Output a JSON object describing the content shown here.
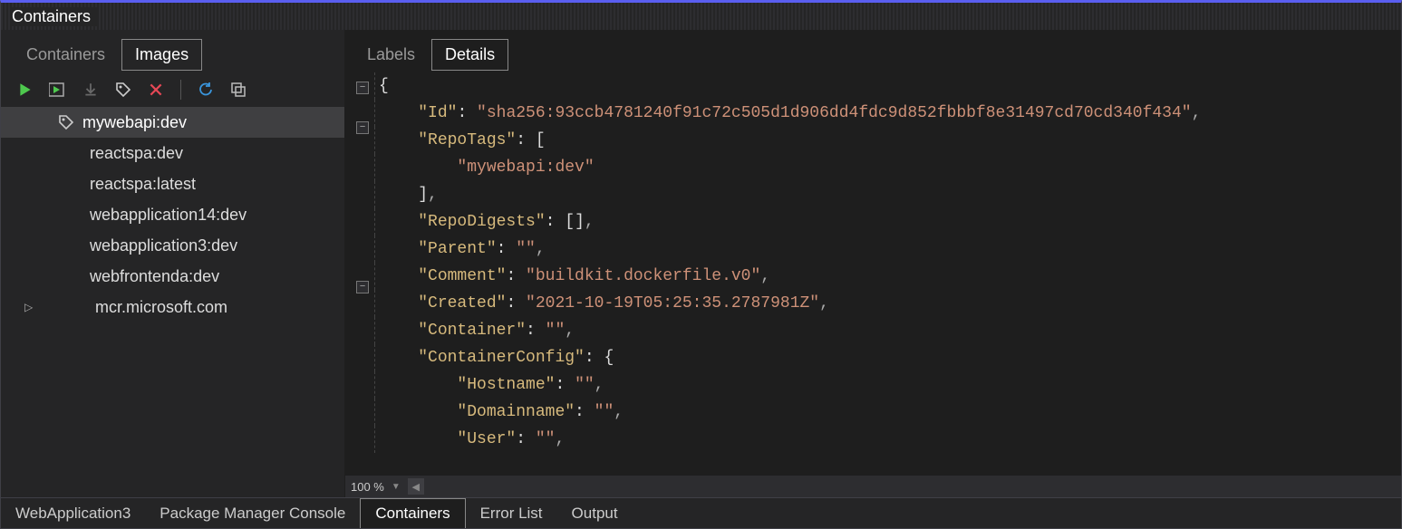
{
  "title": "Containers",
  "left": {
    "tabs": {
      "containers": "Containers",
      "images": "Images",
      "active": "images"
    },
    "items": [
      {
        "label": "mywebapi:dev",
        "selected": true,
        "tagged": true
      },
      {
        "label": "reactspa:dev"
      },
      {
        "label": "reactspa:latest"
      },
      {
        "label": "webapplication14:dev"
      },
      {
        "label": "webapplication3:dev"
      },
      {
        "label": "webfrontenda:dev"
      },
      {
        "label": "mcr.microsoft.com",
        "expandable": true
      }
    ]
  },
  "right": {
    "tabs": {
      "labels": "Labels",
      "details": "Details",
      "active": "details"
    },
    "details": {
      "Id": "sha256:93ccb4781240f91c72c505d1d906dd4fdc9d852fbbbf8e31497cd70cd340f434",
      "RepoTags": [
        "mywebapi:dev"
      ],
      "RepoDigests": [],
      "Parent": "",
      "Comment": "buildkit.dockerfile.v0",
      "Created": "2021-10-19T05:25:35.2787981Z",
      "Container": "",
      "ContainerConfig": {
        "Hostname": "",
        "Domainname": "",
        "User": ""
      }
    },
    "zoom": "100 %"
  },
  "bottom_tabs": [
    {
      "label": "WebApplication3"
    },
    {
      "label": "Package Manager Console"
    },
    {
      "label": "Containers",
      "active": true
    },
    {
      "label": "Error List"
    },
    {
      "label": "Output"
    }
  ],
  "code_lines": [
    {
      "fold": "minus",
      "t": [
        [
          "b",
          "{"
        ]
      ]
    },
    {
      "fold": "",
      "t": [
        [
          "p",
          "    "
        ],
        [
          "k",
          "\"Id\""
        ],
        [
          "p",
          ": "
        ],
        [
          "s",
          "\"sha256:93ccb4781240f91c72c505d1d906dd4fdc9d852fbbbf8e31497cd70cd340f434\""
        ],
        [
          "comma",
          ","
        ]
      ]
    },
    {
      "fold": "minus",
      "t": [
        [
          "p",
          "    "
        ],
        [
          "k",
          "\"RepoTags\""
        ],
        [
          "p",
          ": "
        ],
        [
          "b",
          "["
        ]
      ]
    },
    {
      "fold": "",
      "t": [
        [
          "p",
          "        "
        ],
        [
          "s",
          "\"mywebapi:dev\""
        ]
      ]
    },
    {
      "fold": "",
      "t": [
        [
          "p",
          "    "
        ],
        [
          "b",
          "]"
        ],
        [
          "comma",
          ","
        ]
      ]
    },
    {
      "fold": "",
      "t": [
        [
          "p",
          "    "
        ],
        [
          "k",
          "\"RepoDigests\""
        ],
        [
          "p",
          ": "
        ],
        [
          "b",
          "[]"
        ],
        [
          "comma",
          ","
        ]
      ]
    },
    {
      "fold": "",
      "t": [
        [
          "p",
          "    "
        ],
        [
          "k",
          "\"Parent\""
        ],
        [
          "p",
          ": "
        ],
        [
          "s",
          "\"\""
        ],
        [
          "comma",
          ","
        ]
      ]
    },
    {
      "fold": "",
      "t": [
        [
          "p",
          "    "
        ],
        [
          "k",
          "\"Comment\""
        ],
        [
          "p",
          ": "
        ],
        [
          "s",
          "\"buildkit.dockerfile.v0\""
        ],
        [
          "comma",
          ","
        ]
      ]
    },
    {
      "fold": "",
      "t": [
        [
          "p",
          "    "
        ],
        [
          "k",
          "\"Created\""
        ],
        [
          "p",
          ": "
        ],
        [
          "s",
          "\"2021-10-19T05:25:35.2787981Z\""
        ],
        [
          "comma",
          ","
        ]
      ]
    },
    {
      "fold": "",
      "t": [
        [
          "p",
          "    "
        ],
        [
          "k",
          "\"Container\""
        ],
        [
          "p",
          ": "
        ],
        [
          "s",
          "\"\""
        ],
        [
          "comma",
          ","
        ]
      ]
    },
    {
      "fold": "minus",
      "t": [
        [
          "p",
          "    "
        ],
        [
          "k",
          "\"ContainerConfig\""
        ],
        [
          "p",
          ": "
        ],
        [
          "b",
          "{"
        ]
      ]
    },
    {
      "fold": "",
      "t": [
        [
          "p",
          "        "
        ],
        [
          "k",
          "\"Hostname\""
        ],
        [
          "p",
          ": "
        ],
        [
          "s",
          "\"\""
        ],
        [
          "comma",
          ","
        ]
      ]
    },
    {
      "fold": "",
      "t": [
        [
          "p",
          "        "
        ],
        [
          "k",
          "\"Domainname\""
        ],
        [
          "p",
          ": "
        ],
        [
          "s",
          "\"\""
        ],
        [
          "comma",
          ","
        ]
      ]
    },
    {
      "fold": "",
      "t": [
        [
          "p",
          "        "
        ],
        [
          "k",
          "\"User\""
        ],
        [
          "p",
          ": "
        ],
        [
          "s",
          "\"\""
        ],
        [
          "comma",
          ","
        ]
      ]
    }
  ]
}
